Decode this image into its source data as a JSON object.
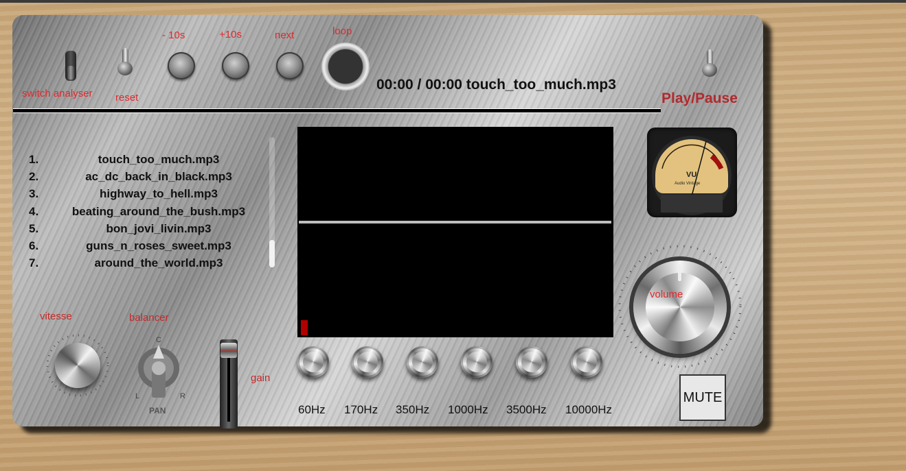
{
  "controls": {
    "switch_analyser": "switch analyser",
    "reset": "reset",
    "back10": "- 10s",
    "fwd10": "+10s",
    "next": "next",
    "loop": "loop",
    "play_pause": "Play/Pause",
    "mute": "MUTE"
  },
  "status": {
    "time_and_track": "00:00 / 00:00 touch_too_much.mp3",
    "progress": 0
  },
  "playlist": [
    {
      "num": "1.",
      "name": "touch_too_much.mp3"
    },
    {
      "num": "2.",
      "name": "ac_dc_back_in_black.mp3"
    },
    {
      "num": "3.",
      "name": "highway_to_hell.mp3"
    },
    {
      "num": "4.",
      "name": "beating_around_the_bush.mp3"
    },
    {
      "num": "5.",
      "name": "bon_jovi_livin.mp3"
    },
    {
      "num": "6.",
      "name": "guns_n_roses_sweet.mp3"
    },
    {
      "num": "7.",
      "name": "around_the_world.mp3"
    }
  ],
  "knobs": {
    "vitesse": "vitesse",
    "balancer": "balancer",
    "gain": "gain",
    "volume": "volume"
  },
  "pan_labels": {
    "c": "C",
    "l": "L",
    "r": "R",
    "pan": "PAN"
  },
  "vu_meter": {
    "label": "VU",
    "brand": "Audio Vintage"
  },
  "equalizer": [
    "60Hz",
    "170Hz",
    "350Hz",
    "1000Hz",
    "3500Hz",
    "10000Hz"
  ],
  "colors": {
    "accent_red": "#e0282d",
    "play_pause": "#b12a2e",
    "analyser_bg": "#000000"
  }
}
